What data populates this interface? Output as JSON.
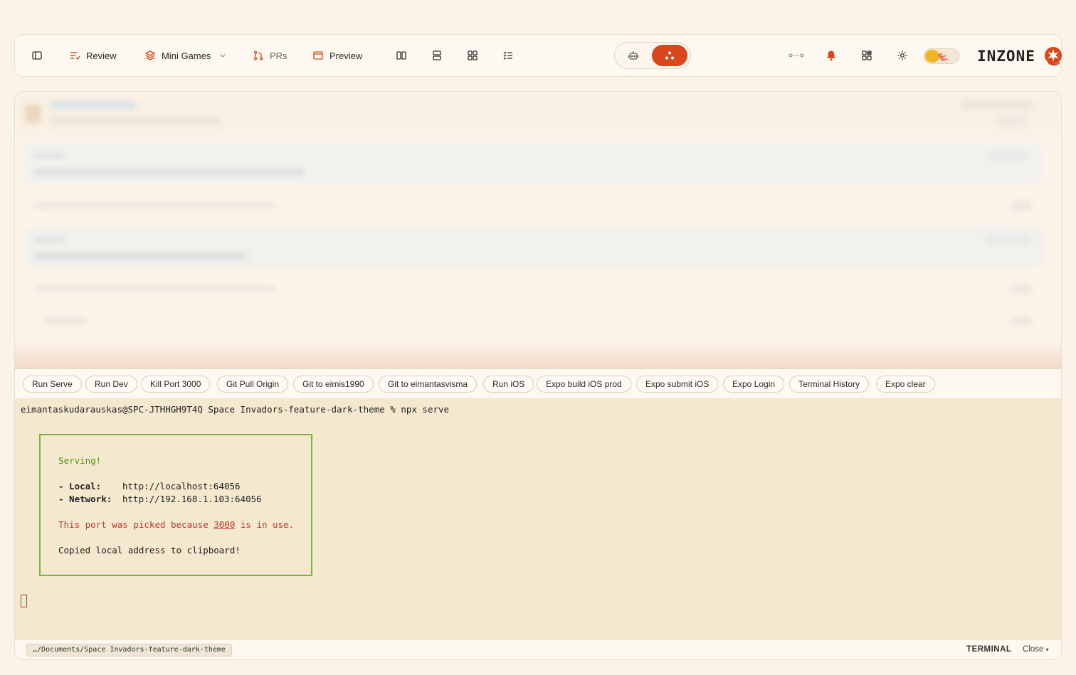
{
  "nav": {
    "review_label": "Review",
    "minigames_label": "Mini Games",
    "prs_label": "PRs",
    "preview_label": "Preview"
  },
  "brand": {
    "name": "INZONE"
  },
  "colors": {
    "accent": "#d9471c",
    "terminal_bg": "#f4e9cf",
    "serve_border": "#7cb342"
  },
  "commands": [
    "Run Serve",
    "Run Dev",
    "Kill Port 3000",
    "Git Pull Origin",
    "Git to eimis1990",
    "Git to eimantasvisma",
    "Run iOS",
    "Expo build iOS prod",
    "Expo submit iOS",
    "Expo Login",
    "Terminal History",
    "Expo clear"
  ],
  "terminal": {
    "prompt_line": "eimantaskudarauskas@SPC-JTHHGH9T4Q Space Invadors-feature-dark-theme % npx serve",
    "serving": "Serving!",
    "local_label": "- Local:",
    "local_url": "http://localhost:64056",
    "network_label": "- Network:",
    "network_url": "http://192.168.1.103:64056",
    "port_msg_pre": "This port was picked because ",
    "port_in_use": "3000",
    "port_msg_post": " is in use.",
    "copied": "Copied local address to clipboard!"
  },
  "footer": {
    "path": "…/Documents/Space Invadors-feature-dark-theme",
    "terminal_label": "TERMINAL",
    "close_label": "Close"
  }
}
